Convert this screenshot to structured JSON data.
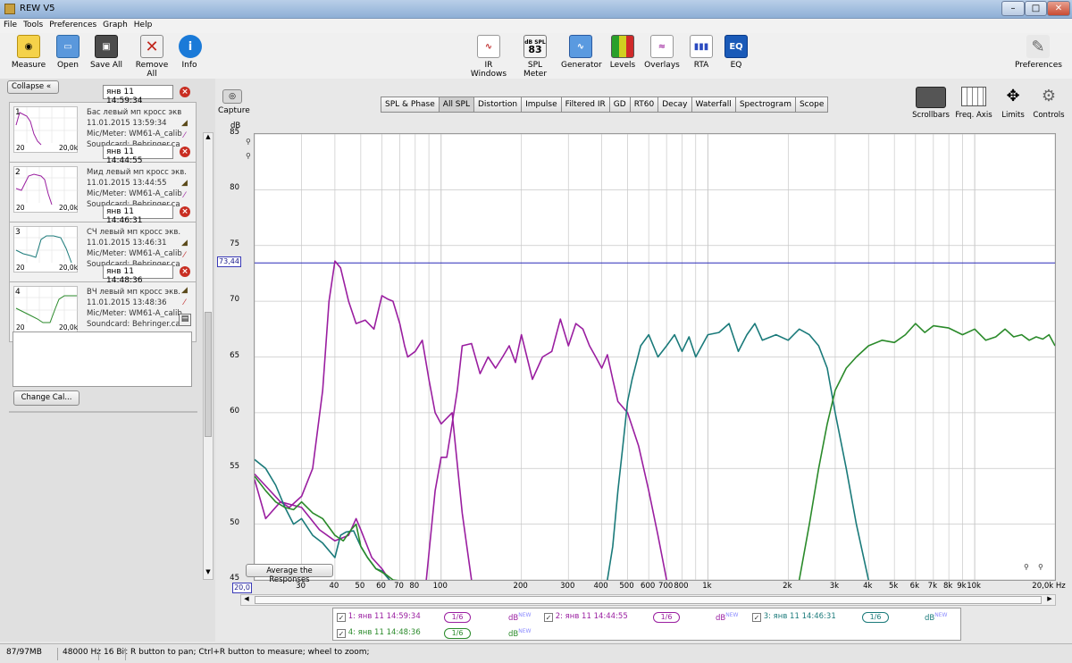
{
  "window": {
    "title": "REW V5"
  },
  "menu": [
    "File",
    "Tools",
    "Preferences",
    "Graph",
    "Help"
  ],
  "toolbar_left": [
    {
      "label": "Measure",
      "icon": "measure-icon"
    },
    {
      "label": "Open",
      "icon": "folder-icon"
    },
    {
      "label": "Save All",
      "icon": "save-all-icon"
    },
    {
      "label": "Remove All",
      "icon": "remove-all-icon"
    },
    {
      "label": "Info",
      "icon": "info-icon"
    }
  ],
  "toolbar_center": [
    {
      "label": "IR Windows",
      "icon": "ir-windows-icon"
    },
    {
      "label": "SPL Meter",
      "icon": "spl-meter-icon",
      "badge": "dB SPL",
      "value": "83"
    },
    {
      "label": "Generator",
      "icon": "generator-icon"
    },
    {
      "label": "Levels",
      "icon": "levels-icon"
    },
    {
      "label": "Overlays",
      "icon": "overlays-icon"
    },
    {
      "label": "RTA",
      "icon": "rta-icon"
    },
    {
      "label": "EQ",
      "icon": "eq-icon",
      "badge": "EQ"
    }
  ],
  "toolbar_right": {
    "label": "Preferences",
    "icon": "wrench-icon"
  },
  "side": {
    "collapse": "Collapse",
    "change_cal": "Change Cal..."
  },
  "measurements": [
    {
      "num": "1",
      "name": "Бас левый мп кросс экв",
      "date": "11.01.2015 13:59:34",
      "mic": "Mic/Meter: WM61-A_calib",
      "sc": "Soundcard: Behringer.ca",
      "time": "янв 11 14:59:34",
      "thumb_start": "20",
      "thumb_end": "20,0k",
      "color": "#9a1ea0"
    },
    {
      "num": "2",
      "name": "Мид левый мп кросс экв.",
      "date": "11.01.2015 13:44:55",
      "mic": "Mic/Meter: WM61-A_calib",
      "sc": "Soundcard: Behringer.ca",
      "time": "янв 11 14:44:55",
      "thumb_start": "20",
      "thumb_end": "20,0k",
      "color": "#9a1ea0"
    },
    {
      "num": "3",
      "name": "СЧ левый мп кросс экв.",
      "date": "11.01.2015 13:46:31",
      "mic": "Mic/Meter: WM61-A_calib",
      "sc": "Soundcard: Behringer.ca",
      "time": "янв 11 14:46:31",
      "thumb_start": "20",
      "thumb_end": "20,0k",
      "color": "#1a7a7a"
    },
    {
      "num": "4",
      "name": "ВЧ левый мп кросс экв.",
      "date": "11.01.2015 13:48:36",
      "mic": "Mic/Meter: WM61-A_calib",
      "sc": "Soundcard: Behringer.ca",
      "time": "янв 11 14:48:36",
      "thumb_start": "20",
      "thumb_end": "20,0k",
      "color": "#2a8a2a"
    }
  ],
  "capture": "Capture",
  "tabs": [
    "SPL & Phase",
    "All SPL",
    "Distortion",
    "Impulse",
    "Filtered IR",
    "GD",
    "RT60",
    "Decay",
    "Waterfall",
    "Spectrogram",
    "Scope"
  ],
  "active_tab": "All SPL",
  "graph_tools": [
    {
      "label": "Scrollbars",
      "icon": "scrollbars-icon"
    },
    {
      "label": "Freq. Axis",
      "icon": "freq-axis-icon"
    },
    {
      "label": "Limits",
      "icon": "limits-icon"
    },
    {
      "label": "Controls",
      "icon": "gear-icon"
    }
  ],
  "average_btn": "Average the Responses",
  "cursor_readout": "73,44",
  "x_start_label": "20,0",
  "legend": [
    {
      "label": "1: янв 11 14:59:34",
      "color": "#9a1ea0",
      "smooth": "1/6",
      "db": "dB",
      "tag": "NEW"
    },
    {
      "label": "2: янв 11 14:44:55",
      "color": "#9a1ea0",
      "smooth": "1/6",
      "db": "dB",
      "tag": "NEW"
    },
    {
      "label": "3: янв 11 14:46:31",
      "color": "#1a7a7a",
      "smooth": "1/6",
      "db": "dB",
      "tag": "NEW"
    },
    {
      "label": "4: янв 11 14:48:36",
      "color": "#2a8a2a",
      "smooth": "1/6",
      "db": "dB",
      "tag": "NEW"
    }
  ],
  "status": [
    "87/97MB",
    "48000 Hz",
    "16 Bit",
    "R button to pan; Ctrl+R button to measure; wheel to zoom;"
  ],
  "chart_data": {
    "type": "line",
    "ylabel": "dB",
    "xlabel": "Hz",
    "xscale": "log",
    "xlim": [
      20,
      20000
    ],
    "ylim": [
      45,
      85
    ],
    "yticks": [
      85,
      80,
      75,
      70,
      65,
      60,
      55,
      50,
      45
    ],
    "xtick_labels": [
      {
        "v": 30,
        "t": "30"
      },
      {
        "v": 40,
        "t": "40"
      },
      {
        "v": 50,
        "t": "50"
      },
      {
        "v": 60,
        "t": "60"
      },
      {
        "v": 70,
        "t": "70"
      },
      {
        "v": 80,
        "t": "80"
      },
      {
        "v": 100,
        "t": "100"
      },
      {
        "v": 200,
        "t": "200"
      },
      {
        "v": 300,
        "t": "300"
      },
      {
        "v": 400,
        "t": "400"
      },
      {
        "v": 500,
        "t": "500"
      },
      {
        "v": 600,
        "t": "600"
      },
      {
        "v": 700,
        "t": "700"
      },
      {
        "v": 800,
        "t": "800"
      },
      {
        "v": 1000,
        "t": "1k"
      },
      {
        "v": 2000,
        "t": "2k"
      },
      {
        "v": 3000,
        "t": "3k"
      },
      {
        "v": 4000,
        "t": "4k"
      },
      {
        "v": 5000,
        "t": "5k"
      },
      {
        "v": 6000,
        "t": "6k"
      },
      {
        "v": 7000,
        "t": "7k"
      },
      {
        "v": 8000,
        "t": "8k"
      },
      {
        "v": 9000,
        "t": "9k"
      },
      {
        "v": 10000,
        "t": "10k"
      },
      {
        "v": 20000,
        "t": "20,0k Hz"
      }
    ],
    "cursor_level": 73.44,
    "series": [
      {
        "color": "#9a1ea0",
        "points": [
          [
            20,
            54
          ],
          [
            22,
            50.5
          ],
          [
            25,
            52
          ],
          [
            27,
            51.5
          ],
          [
            30,
            52.5
          ],
          [
            33,
            55
          ],
          [
            36,
            62
          ],
          [
            38,
            70
          ],
          [
            40,
            73.6
          ],
          [
            42,
            73
          ],
          [
            45,
            70
          ],
          [
            48,
            68
          ],
          [
            52,
            68.3
          ],
          [
            56,
            67.5
          ],
          [
            60,
            70.5
          ],
          [
            63,
            70.2
          ],
          [
            66,
            70
          ],
          [
            70,
            68
          ],
          [
            73,
            66
          ],
          [
            75,
            65
          ],
          [
            80,
            65.5
          ],
          [
            85,
            66.5
          ],
          [
            90,
            63
          ],
          [
            95,
            60
          ],
          [
            100,
            59
          ],
          [
            105,
            59.5
          ],
          [
            110,
            60
          ],
          [
            120,
            51
          ],
          [
            130,
            45
          ]
        ]
      },
      {
        "color": "#9a1ea0",
        "points": [
          [
            20,
            54.5
          ],
          [
            25,
            52
          ],
          [
            30,
            51.5
          ],
          [
            35,
            49.5
          ],
          [
            40,
            48.5
          ],
          [
            45,
            49
          ],
          [
            48,
            50.5
          ],
          [
            50,
            49.5
          ],
          [
            55,
            47
          ],
          [
            60,
            46
          ],
          [
            64,
            45
          ],
          [
            75,
            43
          ],
          [
            80,
            43.5
          ],
          [
            88,
            45
          ],
          [
            95,
            53
          ],
          [
            100,
            56
          ],
          [
            105,
            56
          ],
          [
            110,
            59
          ],
          [
            115,
            62
          ],
          [
            120,
            66
          ],
          [
            130,
            66.2
          ],
          [
            140,
            63.5
          ],
          [
            150,
            65
          ],
          [
            160,
            64
          ],
          [
            170,
            65
          ],
          [
            180,
            66
          ],
          [
            190,
            64.5
          ],
          [
            200,
            67
          ],
          [
            220,
            63
          ],
          [
            240,
            65
          ],
          [
            260,
            65.5
          ],
          [
            280,
            68.4
          ],
          [
            300,
            66
          ],
          [
            320,
            68
          ],
          [
            340,
            67.5
          ],
          [
            360,
            66
          ],
          [
            380,
            65
          ],
          [
            400,
            64
          ],
          [
            420,
            65.2
          ],
          [
            440,
            63
          ],
          [
            460,
            61
          ],
          [
            500,
            60
          ],
          [
            550,
            57
          ],
          [
            600,
            53
          ],
          [
            650,
            49
          ],
          [
            700,
            45
          ]
        ]
      },
      {
        "color": "#1a7a7a",
        "points": [
          [
            20,
            55.8
          ],
          [
            22,
            55
          ],
          [
            24,
            53.5
          ],
          [
            26,
            51.5
          ],
          [
            28,
            50
          ],
          [
            30,
            50.5
          ],
          [
            33,
            49
          ],
          [
            36,
            48.3
          ],
          [
            40,
            47
          ],
          [
            42,
            49
          ],
          [
            44,
            49.3
          ],
          [
            47,
            49.4
          ],
          [
            50,
            48
          ],
          [
            53,
            47
          ],
          [
            57,
            46
          ],
          [
            60,
            45.8
          ],
          [
            64,
            45
          ],
          [
            70,
            44
          ],
          [
            80,
            42
          ],
          [
            100,
            40
          ],
          [
            200,
            38
          ],
          [
            300,
            40
          ],
          [
            380,
            42
          ],
          [
            420,
            45
          ],
          [
            440,
            48
          ],
          [
            460,
            53
          ],
          [
            480,
            57
          ],
          [
            500,
            61
          ],
          [
            520,
            63
          ],
          [
            560,
            66
          ],
          [
            600,
            67
          ],
          [
            650,
            65
          ],
          [
            700,
            66
          ],
          [
            750,
            67
          ],
          [
            800,
            65.5
          ],
          [
            850,
            66.8
          ],
          [
            900,
            65
          ],
          [
            1000,
            67
          ],
          [
            1100,
            67.2
          ],
          [
            1200,
            68
          ],
          [
            1300,
            65.5
          ],
          [
            1400,
            67
          ],
          [
            1500,
            68
          ],
          [
            1600,
            66.5
          ],
          [
            1800,
            67
          ],
          [
            2000,
            66.5
          ],
          [
            2200,
            67.5
          ],
          [
            2400,
            67
          ],
          [
            2600,
            66
          ],
          [
            2800,
            64
          ],
          [
            3000,
            60
          ],
          [
            3300,
            55
          ],
          [
            3600,
            50
          ],
          [
            4000,
            45
          ]
        ]
      },
      {
        "color": "#2a8a2a",
        "points": [
          [
            20,
            54.3
          ],
          [
            22,
            53
          ],
          [
            24,
            52
          ],
          [
            26,
            51.5
          ],
          [
            28,
            51.3
          ],
          [
            30,
            52
          ],
          [
            33,
            51
          ],
          [
            36,
            50.5
          ],
          [
            40,
            49
          ],
          [
            43,
            48.5
          ],
          [
            46,
            49.5
          ],
          [
            48,
            50
          ],
          [
            50,
            48
          ],
          [
            53,
            47
          ],
          [
            57,
            46
          ],
          [
            62,
            45.5
          ],
          [
            66,
            45
          ],
          [
            2000,
            40
          ],
          [
            2200,
            45
          ],
          [
            2400,
            50
          ],
          [
            2600,
            55
          ],
          [
            2800,
            59
          ],
          [
            3000,
            62
          ],
          [
            3300,
            64
          ],
          [
            3600,
            65
          ],
          [
            4000,
            66
          ],
          [
            4500,
            66.5
          ],
          [
            5000,
            66.3
          ],
          [
            5500,
            67
          ],
          [
            6000,
            68
          ],
          [
            6500,
            67.2
          ],
          [
            7000,
            67.8
          ],
          [
            8000,
            67.6
          ],
          [
            9000,
            67
          ],
          [
            10000,
            67.5
          ],
          [
            11000,
            66.5
          ],
          [
            12000,
            66.8
          ],
          [
            13000,
            67.5
          ],
          [
            14000,
            66.8
          ],
          [
            15000,
            67
          ],
          [
            16000,
            66.5
          ],
          [
            17000,
            66.8
          ],
          [
            18000,
            66.6
          ],
          [
            19000,
            67
          ],
          [
            20000,
            66
          ]
        ]
      }
    ]
  }
}
